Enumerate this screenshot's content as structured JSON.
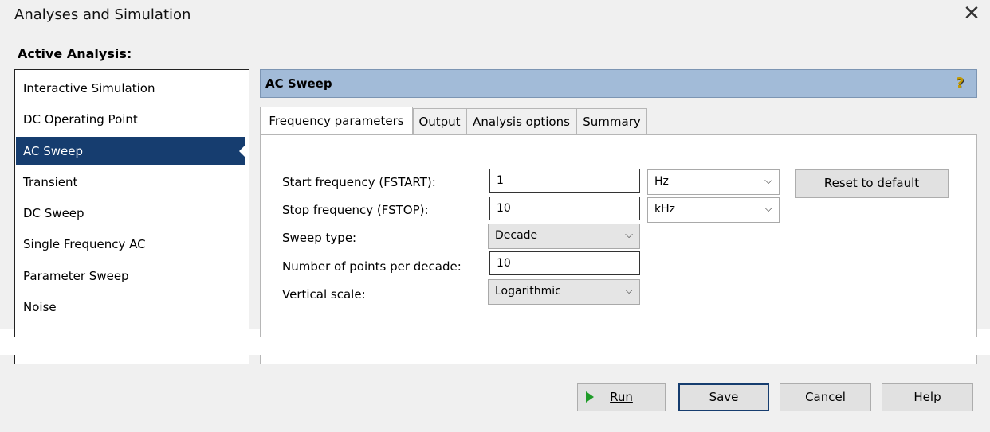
{
  "window": {
    "title": "Analyses and Simulation",
    "close_glyph": "✕"
  },
  "active_analysis_label": "Active Analysis:",
  "analyses": [
    {
      "label": "Interactive Simulation"
    },
    {
      "label": "DC Operating Point"
    },
    {
      "label": "AC Sweep",
      "selected": true
    },
    {
      "label": "Transient"
    },
    {
      "label": "DC Sweep"
    },
    {
      "label": "Single Frequency AC"
    },
    {
      "label": "Parameter Sweep"
    },
    {
      "label": "Noise"
    }
  ],
  "panel": {
    "title": "AC Sweep",
    "help_glyph": "?"
  },
  "tabs": [
    {
      "label": "Frequency parameters",
      "active": true
    },
    {
      "label": "Output"
    },
    {
      "label": "Analysis options"
    },
    {
      "label": "Summary"
    }
  ],
  "form": {
    "start_freq": {
      "label": "Start frequency (FSTART):",
      "value": "1",
      "unit": "Hz"
    },
    "stop_freq": {
      "label": "Stop frequency (FSTOP):",
      "value": "10",
      "unit": "kHz"
    },
    "sweep_type": {
      "label": "Sweep type:",
      "value": "Decade"
    },
    "points": {
      "label": "Number of points per decade:",
      "value": "10"
    },
    "vertical_scale": {
      "label": "Vertical scale:",
      "value": "Logarithmic"
    },
    "reset_label": "Reset to default",
    "chevron": "⌵"
  },
  "buttons": {
    "run": "Run",
    "save": "Save",
    "cancel": "Cancel",
    "help": "Help"
  },
  "colors": {
    "selected_bg": "#163d6f",
    "header_bg": "#a2bbd8",
    "run_icon": "#1e9b28"
  }
}
